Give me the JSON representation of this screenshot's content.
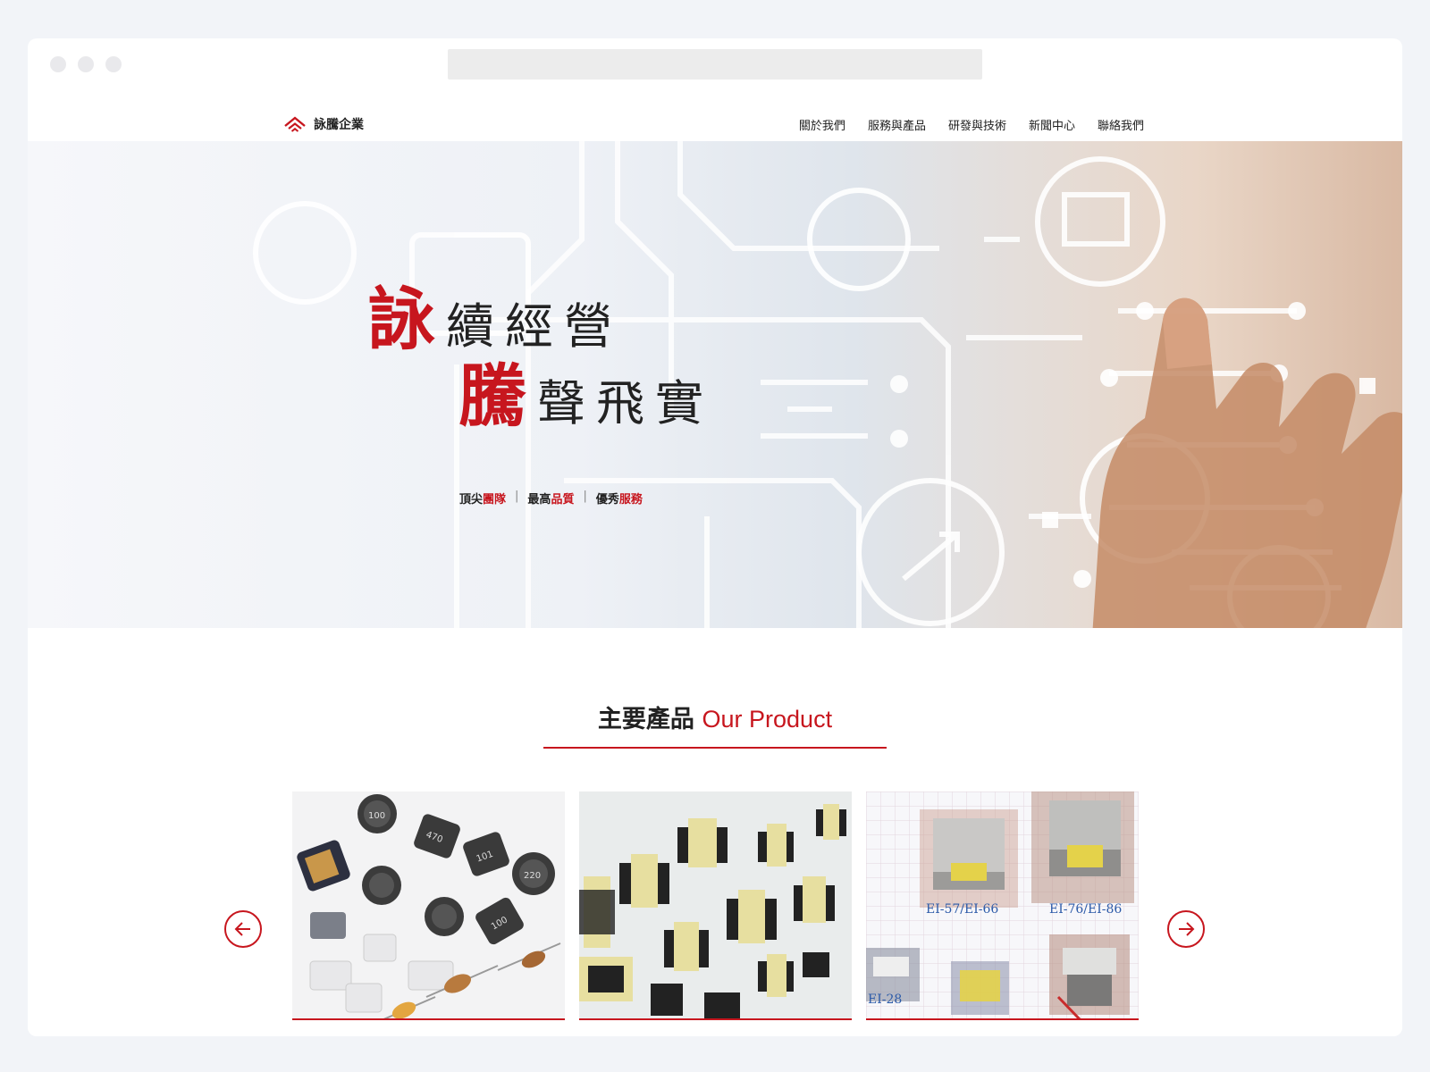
{
  "brand": {
    "name": "詠騰企業",
    "accent": "#c7161e"
  },
  "nav": {
    "items": [
      {
        "label": "關於我們"
      },
      {
        "label": "服務與產品"
      },
      {
        "label": "研發與技術"
      },
      {
        "label": "新聞中心"
      },
      {
        "label": "聯絡我們"
      }
    ]
  },
  "hero": {
    "line1_red": "詠",
    "line1_black": "續經營",
    "line2_red": "騰",
    "line2_black": "聲飛實",
    "tagline": {
      "part1_black": "頂尖",
      "part1_red": "團隊",
      "part2_black": "最高",
      "part2_red": "品質",
      "part3_black": "優秀",
      "part3_red": "服務",
      "separator": "|"
    }
  },
  "products": {
    "title_zh": "主要產品",
    "title_en": "Our Product",
    "cards": [
      {
        "icon": "smd-inductor-components-image",
        "labels": [
          "100",
          "470",
          "101",
          "220",
          "100"
        ]
      },
      {
        "icon": "ferrite-transformer-cores-image",
        "labels": []
      },
      {
        "icon": "ei-transformer-catalog-image",
        "labels": [
          "EI-57/EI-66",
          "EI-76/EI-86",
          "EI-28"
        ]
      }
    ],
    "prev_icon": "arrow-left-icon",
    "next_icon": "arrow-right-icon"
  }
}
